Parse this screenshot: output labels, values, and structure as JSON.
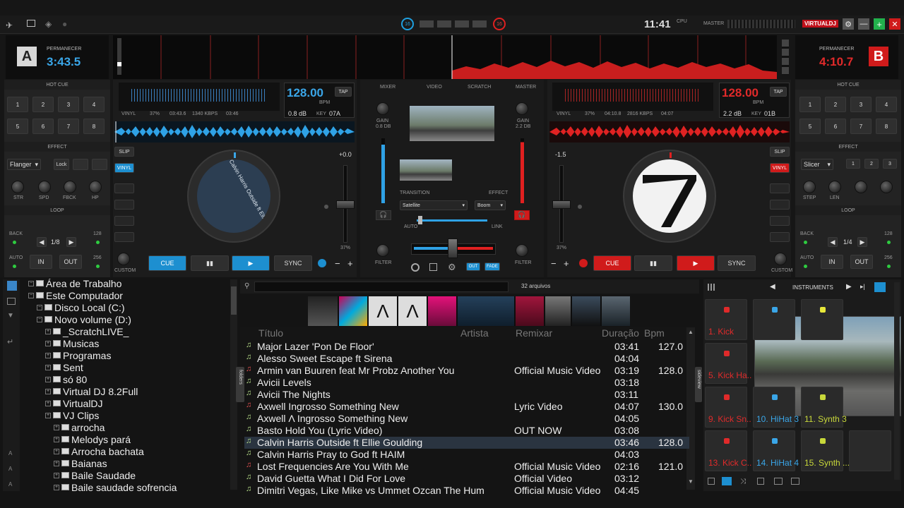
{
  "top": {
    "clock": "11:41",
    "cpu_label": "CPU",
    "master_label": "MASTER",
    "logo": "VIRTUALDJ",
    "left_badge": "16",
    "right_badge": "16"
  },
  "deck_a": {
    "letter": "A",
    "mode": "PERMANECER",
    "time": "3:43.5",
    "bpm": "128.00",
    "bpm_unit": "BPM",
    "tap": "TAP",
    "gain_db": "0.8 dB",
    "key_label": "KEY",
    "key": "07A",
    "info": [
      "VINYL",
      "37%",
      "03:43.6",
      "1340 KBPS",
      "03:46"
    ],
    "pitch": "+0.0",
    "pitch_pct": "37%",
    "disc_text": "Calvin Harris  Outside ft Ellie G",
    "slip": "SLIP",
    "vinyl": "VINYL",
    "cue": "CUE",
    "pause": "▮▮",
    "play": "▶",
    "sync": "SYNC",
    "custom": "CUSTOM"
  },
  "deck_b": {
    "letter": "B",
    "mode": "PERMANECER",
    "time": "4:10.7",
    "bpm": "128.00",
    "bpm_unit": "BPM",
    "tap": "TAP",
    "gain_db": "2.2 dB",
    "key_label": "KEY",
    "key": "01B",
    "info": [
      "VINYL",
      "37%",
      "04:10.8",
      "2816 KBPS",
      "04:07"
    ],
    "pitch": "-1.5",
    "pitch_pct": "37%",
    "slip": "SLIP",
    "vinyl": "VINYL",
    "cue": "CUE",
    "pause": "▮▮",
    "play": "▶",
    "sync": "SYNC",
    "custom": "CUSTOM"
  },
  "left_panel": {
    "hotcue": "HOT CUE",
    "pads": [
      "1",
      "2",
      "3",
      "4",
      "5",
      "6",
      "7",
      "8"
    ],
    "effect": "EFFECT",
    "effect_name": "Flanger",
    "lock": "Lock",
    "knobs": [
      "STR",
      "SPD",
      "FBCK",
      "HP"
    ],
    "loop": "LOOP",
    "back": "BACK",
    "loop_size": "1/8",
    "auto": "AUTO",
    "in": "IN",
    "out": "OUT",
    "n128": "128",
    "n256": "256"
  },
  "right_panel": {
    "hotcue": "HOT CUE",
    "pads": [
      "1",
      "2",
      "3",
      "4",
      "5",
      "6",
      "7",
      "8"
    ],
    "effect": "EFFECT",
    "effect_name": "Slicer",
    "fx_nums": [
      "1",
      "2",
      "3"
    ],
    "knobs": [
      "STEP",
      "LEN"
    ],
    "loop": "LOOP",
    "back": "BACK",
    "loop_size": "1/4",
    "auto": "AUTO",
    "in": "IN",
    "out": "OUT",
    "n128": "128",
    "n256": "256"
  },
  "mixer": {
    "tabs": [
      "MIXER",
      "VIDEO",
      "SCRATCH",
      "MASTER"
    ],
    "gain": "GAIN",
    "gain_a": "0.8 dB",
    "gain_b": "2.2 dB",
    "transition": "TRANSITION",
    "effect": "EFFECT",
    "transition_name": "Satellite",
    "effect_name": "Boom",
    "auto": "AUTO",
    "link": "LINK",
    "filter": "FILTER",
    "out": "OUT",
    "fade": "FADE"
  },
  "browser": {
    "file_count": "32 arquivos",
    "folders_tab": "folders",
    "sideview_tab": "sideview",
    "tree": [
      {
        "label": "Área de Trabalho",
        "level": 0
      },
      {
        "label": "Este Computador",
        "level": 0
      },
      {
        "label": "Disco Local (C:)",
        "level": 1
      },
      {
        "label": "Novo volume (D:)",
        "level": 1
      },
      {
        "label": "_ScratchLIVE_",
        "level": 2
      },
      {
        "label": "Musicas",
        "level": 2
      },
      {
        "label": "Programas",
        "level": 2
      },
      {
        "label": "Sent",
        "level": 2
      },
      {
        "label": "só 80",
        "level": 2
      },
      {
        "label": "Virtual DJ 8.2Full",
        "level": 2
      },
      {
        "label": "VirtualDJ",
        "level": 2
      },
      {
        "label": "VJ  Clips",
        "level": 2
      },
      {
        "label": "arrocha",
        "level": 3
      },
      {
        "label": "Melodys pará",
        "level": 3
      },
      {
        "label": "Arrocha bachata",
        "level": 3
      },
      {
        "label": "Baianas",
        "level": 3
      },
      {
        "label": "Baile Saudade",
        "level": 3
      },
      {
        "label": "Baile saudade sofrencia",
        "level": 3
      }
    ],
    "columns": [
      "Título",
      "Artista",
      "Remixar",
      "Duração",
      "Bpm"
    ],
    "tracks": [
      {
        "title": "Major Lazer 'Pon De Floor'",
        "remix": "",
        "dur": "03:41",
        "bpm": "127.0",
        "video": true
      },
      {
        "title": "Alesso   Sweet Escape ft Sirena",
        "remix": "",
        "dur": "04:04",
        "bpm": "",
        "video": true
      },
      {
        "title": "Armin van Buuren feat Mr Probz   Another You",
        "remix": "Official Music Video",
        "dur": "03:19",
        "bpm": "128.0",
        "video": false
      },
      {
        "title": "Avicii   Levels",
        "remix": "",
        "dur": "03:18",
        "bpm": "",
        "video": true
      },
      {
        "title": "Avicii   The Nights",
        "remix": "",
        "dur": "03:11",
        "bpm": "",
        "video": true
      },
      {
        "title": "Axwell Ingrosso   Something New",
        "remix": "Lyric Video",
        "dur": "04:07",
        "bpm": "130.0",
        "video": false
      },
      {
        "title": "Axwell Λ Ingrosso   Something New",
        "remix": "",
        "dur": "04:05",
        "bpm": "",
        "video": true
      },
      {
        "title": "Basto   Hold You (Lyric Video)",
        "remix": "OUT NOW",
        "dur": "03:08",
        "bpm": "",
        "video": true
      },
      {
        "title": "Calvin Harris   Outside ft Ellie Goulding",
        "remix": "",
        "dur": "03:46",
        "bpm": "128.0",
        "video": true,
        "selected": true
      },
      {
        "title": "Calvin Harris   Pray to God ft HAIM",
        "remix": "",
        "dur": "04:03",
        "bpm": "",
        "video": true
      },
      {
        "title": "Lost Frequencies   Are You With Me",
        "remix": "Official Music Video",
        "dur": "02:16",
        "bpm": "121.0",
        "video": false
      },
      {
        "title": "David Guetta   What I Did For Love",
        "remix": "Official Video",
        "dur": "03:12",
        "bpm": "",
        "video": true
      },
      {
        "title": "Dimitri Vegas, Like Mike vs Ummet Ozcan   The Hum",
        "remix": "Official Music Video",
        "dur": "04:45",
        "bpm": "",
        "video": true
      }
    ]
  },
  "sampler": {
    "bank": "INSTRUMENTS",
    "pads": [
      "1. Kick",
      "5. Kick Ha..",
      "9. Kick Sn..",
      "13. Kick C..",
      "14. HiHat 4",
      "15. Synth ...",
      "",
      "",
      "11. Synth 3",
      "10. HiHat 3"
    ]
  }
}
